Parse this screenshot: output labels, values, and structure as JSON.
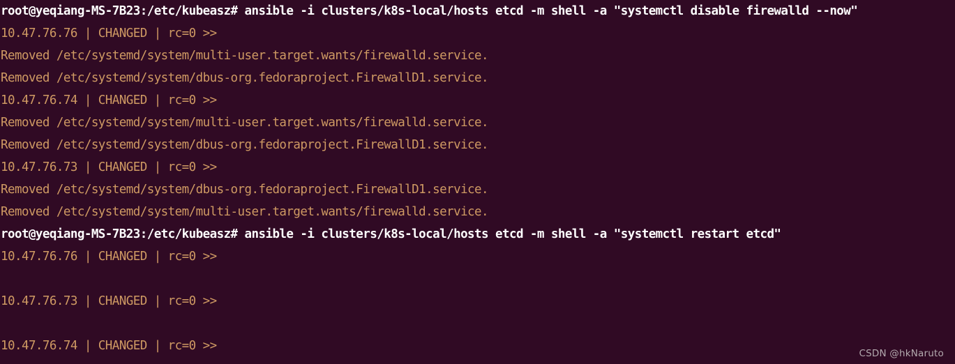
{
  "terminal": {
    "background_color": "#300a24",
    "prompt_color": "#ffffff",
    "output_color": "#cf9a63",
    "prompt_string": "root@yeqiang-MS-7B23:/etc/kubeasz#",
    "lines": [
      {
        "kind": "prompt",
        "text": "root@yeqiang-MS-7B23:/etc/kubeasz# ansible -i clusters/k8s-local/hosts etcd -m shell -a \"systemctl disable firewalld --now\""
      },
      {
        "kind": "status",
        "text": "10.47.76.76 | CHANGED | rc=0 >>"
      },
      {
        "kind": "removed",
        "text": "Removed /etc/systemd/system/multi-user.target.wants/firewalld.service."
      },
      {
        "kind": "removed",
        "text": "Removed /etc/systemd/system/dbus-org.fedoraproject.FirewallD1.service."
      },
      {
        "kind": "status",
        "text": "10.47.76.74 | CHANGED | rc=0 >>"
      },
      {
        "kind": "removed",
        "text": "Removed /etc/systemd/system/multi-user.target.wants/firewalld.service."
      },
      {
        "kind": "removed",
        "text": "Removed /etc/systemd/system/dbus-org.fedoraproject.FirewallD1.service."
      },
      {
        "kind": "status",
        "text": "10.47.76.73 | CHANGED | rc=0 >>"
      },
      {
        "kind": "removed",
        "text": "Removed /etc/systemd/system/dbus-org.fedoraproject.FirewallD1.service."
      },
      {
        "kind": "removed",
        "text": "Removed /etc/systemd/system/multi-user.target.wants/firewalld.service."
      },
      {
        "kind": "prompt",
        "text": "root@yeqiang-MS-7B23:/etc/kubeasz# ansible -i clusters/k8s-local/hosts etcd -m shell -a \"systemctl restart etcd\""
      },
      {
        "kind": "status",
        "text": "10.47.76.76 | CHANGED | rc=0 >>"
      },
      {
        "kind": "blank",
        "text": ""
      },
      {
        "kind": "status",
        "text": "10.47.76.73 | CHANGED | rc=0 >>"
      },
      {
        "kind": "blank",
        "text": ""
      },
      {
        "kind": "status",
        "text": "10.47.76.74 | CHANGED | rc=0 >>"
      }
    ]
  },
  "watermark": {
    "text": "CSDN @hkNaruto",
    "color": "#b3a9ae"
  }
}
